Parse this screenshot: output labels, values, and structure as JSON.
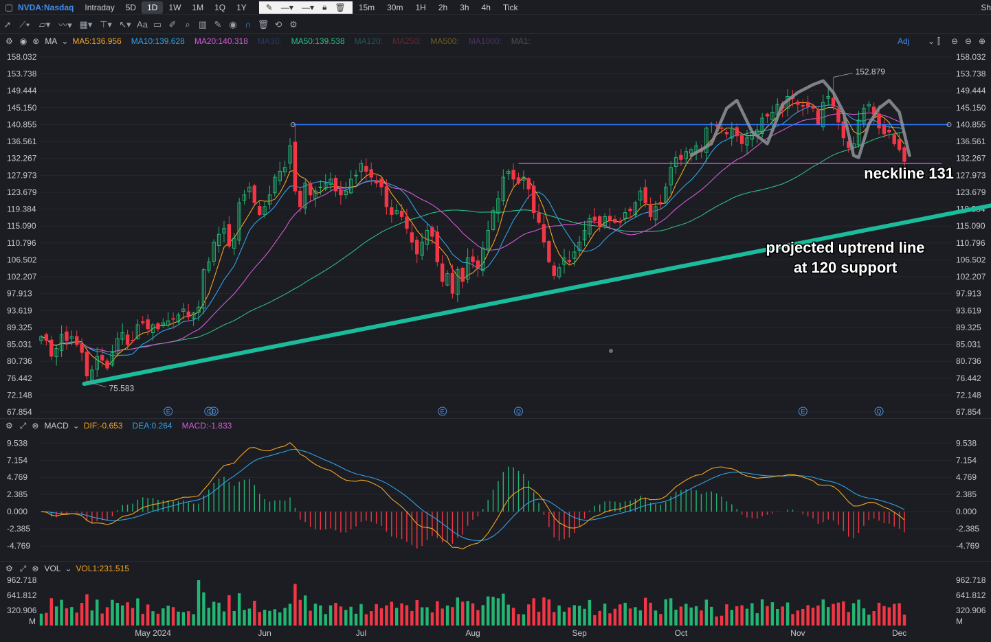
{
  "header": {
    "symbol": "NVDA:Nasdaq",
    "timeframes": [
      "Intraday",
      "5D",
      "1D",
      "1W",
      "1M",
      "1Q",
      "1Y"
    ],
    "active_timeframe": "1D",
    "intervals": [
      "15m",
      "30m",
      "1H",
      "2h",
      "3h",
      "4h",
      "Tick"
    ],
    "right_text": "Sh"
  },
  "main_legend": {
    "indicator": "MA",
    "ma5": "MA5:136.956",
    "ma10": "MA10:139.628",
    "ma20": "MA20:140.318",
    "ma30": "MA30:",
    "ma50": "MA50:139.538",
    "ma120": "MA120:",
    "ma250": "MA250:",
    "ma500": "MA500:",
    "ma1000": "MA1000:",
    "ma1": "MA1:",
    "adj": "Adj"
  },
  "macd_legend": {
    "indicator": "MACD",
    "dif": "DIF:-0.653",
    "dea": "DEA:0.264",
    "macd": "MACD:-1.833"
  },
  "vol_legend": {
    "indicator": "VOL",
    "vol1": "VOL1:231.515"
  },
  "colors": {
    "up": "#22b573",
    "down": "#f23645",
    "ma5": "#f5a623",
    "ma10": "#2ea3e8",
    "ma20": "#d45ad8",
    "ma50": "#2ebd85",
    "uptrend": "#1abc9c",
    "resistance": "#2f7bff",
    "neckline": "#e040e0"
  },
  "chart_data": [
    {
      "type": "candlestick",
      "title": "NVDA:Nasdaq 1D",
      "ylim": [
        67.854,
        158.032
      ],
      "y_ticks": [
        "158.032",
        "153.738",
        "149.444",
        "145.150",
        "140.855",
        "136.561",
        "132.267",
        "127.973",
        "123.679",
        "119.384",
        "115.090",
        "110.796",
        "106.502",
        "102.207",
        "97.913",
        "93.619",
        "89.325",
        "85.031",
        "80.736",
        "76.442",
        "72.148",
        "67.854"
      ],
      "x_labels": [
        {
          "label": "May 2024",
          "i": 22
        },
        {
          "label": "Jun",
          "i": 44
        },
        {
          "label": "Jul",
          "i": 63
        },
        {
          "label": "Aug",
          "i": 85
        },
        {
          "label": "Sep",
          "i": 106
        },
        {
          "label": "Oct",
          "i": 126
        },
        {
          "label": "Nov",
          "i": 149
        },
        {
          "label": "Dec",
          "i": 169
        }
      ],
      "close": [
        87.0,
        86.0,
        82.0,
        84.0,
        87.5,
        86.0,
        87.0,
        85.0,
        83.0,
        77.0,
        78.5,
        82.0,
        81.0,
        79.0,
        83.0,
        86.5,
        88.0,
        85.0,
        86.0,
        90.0,
        90.5,
        89.0,
        90.0,
        89.0,
        90.5,
        91.0,
        91.5,
        92.5,
        94.0,
        92.0,
        93.0,
        94.5,
        104.0,
        106.0,
        111.0,
        113.0,
        114.5,
        110.0,
        112.0,
        121.0,
        123.0,
        125.0,
        121.0,
        118.0,
        120.0,
        123.0,
        127.5,
        129.0,
        130.0,
        135.5,
        124.0,
        120.0,
        126.0,
        123.0,
        124.0,
        125.0,
        126.0,
        127.0,
        124.0,
        123.0,
        124.0,
        127.0,
        128.0,
        131.0,
        129.0,
        127.5,
        126.0,
        125.0,
        120.0,
        118.0,
        119.0,
        117.5,
        114.5,
        111.0,
        108.0,
        111.0,
        114.0,
        112.5,
        106.0,
        101.0,
        103.0,
        98.0,
        104.0,
        101.0,
        107.0,
        106.0,
        104.5,
        109.5,
        114.0,
        119.0,
        122.0,
        127.5,
        129.0,
        127.0,
        126.0,
        127.5,
        124.5,
        118.5,
        116.0,
        111.0,
        106.0,
        102.5,
        104.5,
        107.0,
        106.0,
        108.5,
        111.0,
        114.0,
        117.0,
        116.5,
        115.0,
        117.5,
        116.5,
        116.0,
        116.0,
        118.5,
        119.0,
        121.0,
        124.0,
        121.0,
        117.5,
        120.0,
        121.0,
        125.0,
        130.0,
        132.5,
        132.0,
        134.0,
        134.5,
        135.5,
        134.0,
        140.0,
        141.0,
        140.5,
        140.0,
        138.5,
        140.0,
        138.0,
        136.0,
        137.5,
        139.0,
        139.5,
        142.5,
        143.0,
        144.0,
        146.0,
        145.0,
        148.0,
        147.5,
        146.0,
        145.5,
        145.5,
        145.0,
        141.0,
        146.5,
        148.0,
        145.5,
        141.5,
        137.5,
        135.0,
        136.0,
        142.0,
        145.0,
        146.0,
        143.5,
        140.0,
        138.5,
        139.0,
        136.0,
        134.5,
        131.5
      ],
      "annotations": {
        "high_label": "152.879",
        "high_value": 152.879,
        "high_index": 156,
        "low_label": "75.583",
        "low_value": 75.583,
        "low_index": 9,
        "neckline_text": "neckline 131",
        "uptrend_text": [
          "projected uptrend line",
          "at 120 support"
        ],
        "event_markers": [
          {
            "i": 25,
            "t": "E"
          },
          {
            "i": 33,
            "t": "C"
          },
          {
            "i": 34,
            "t": "Q"
          },
          {
            "i": 79,
            "t": "E"
          },
          {
            "i": 94,
            "t": "Q"
          },
          {
            "i": 150,
            "t": "E"
          },
          {
            "i": 165,
            "t": "Q"
          }
        ]
      }
    },
    {
      "type": "macd",
      "ylim": [
        -6.0,
        11.0
      ],
      "y_ticks": [
        "9.538",
        "7.154",
        "4.769",
        "2.385",
        "0.000",
        "-2.385",
        "-4.769"
      ],
      "dif_last": -0.653,
      "dea_last": 0.264,
      "macd_last": -1.833
    },
    {
      "type": "bar",
      "series": "volume",
      "y_ticks": [
        "962.718",
        "641.812",
        "320.906"
      ],
      "unit": "M",
      "last": 231.515
    }
  ]
}
